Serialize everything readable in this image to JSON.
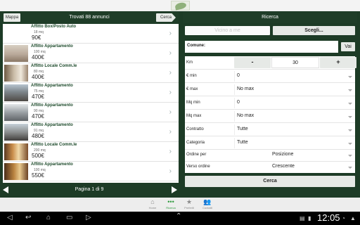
{
  "left_header": {
    "map_button": "Mappa",
    "title": "Trovati 88 annunci",
    "search_button": "Cerca"
  },
  "listings": [
    {
      "title": "Affitto Box/Posto Auto",
      "area": "18",
      "unit": "mq",
      "price": "90€",
      "photo": "blank"
    },
    {
      "title": "Affitto Appartamento",
      "area": "100",
      "unit": "mq",
      "price": "400€",
      "photo": "interior"
    },
    {
      "title": "Affitto Locale Comm.le",
      "area": "80",
      "unit": "mq",
      "price": "400€",
      "photo": "shop"
    },
    {
      "title": "Affitto Appartamento",
      "area": "75",
      "unit": "mq",
      "price": "470€",
      "photo": "building"
    },
    {
      "title": "Affitto Appartamento",
      "area": "90",
      "unit": "mq",
      "price": "470€",
      "photo": "facade"
    },
    {
      "title": "Affitto Appartamento",
      "area": "91",
      "unit": "mq",
      "price": "480€",
      "photo": "building"
    },
    {
      "title": "Affitto Locale Comm.le",
      "area": "200",
      "unit": "mq",
      "price": "500€",
      "photo": "showroom"
    },
    {
      "title": "Affitto Appartamento",
      "area": "100",
      "unit": "mq",
      "price": "550€",
      "photo": "showroom"
    }
  ],
  "pager": {
    "label": "Pagina 1 di 9"
  },
  "right_header": {
    "title": "Ricerca"
  },
  "near_me": {
    "label": "Vicino a me"
  },
  "choose": {
    "label": "Scegli..."
  },
  "comune": {
    "label": "Comune:",
    "value": "",
    "go_button": "Vai"
  },
  "km": {
    "label": "Km",
    "minus": "-",
    "value": "30",
    "plus": "+"
  },
  "fields": [
    {
      "label": "€ min",
      "value": "0"
    },
    {
      "label": "€ max",
      "value": "No max"
    },
    {
      "label": "Mq min",
      "value": "0"
    },
    {
      "label": "Mq max",
      "value": "No max"
    },
    {
      "label": "Contratto",
      "value": "Tutte"
    },
    {
      "label": "Categoria",
      "value": "Tutte"
    }
  ],
  "sort": [
    {
      "label": "Ordine per",
      "value": "Posizione"
    },
    {
      "label": "Verso ordine",
      "value": "Crescente"
    }
  ],
  "search_button": {
    "label": "Cerca"
  },
  "tabs": [
    {
      "label": "Home",
      "icon": "house-icon"
    },
    {
      "label": "Ricerca",
      "icon": "dots-icon",
      "active": true
    },
    {
      "label": "Preferiti",
      "icon": "star-icon"
    },
    {
      "label": "Contatti",
      "icon": "people-icon"
    }
  ],
  "status": {
    "time": "12:05"
  },
  "colors": {
    "brand_green": "#1d3b26",
    "accent_green": "#2e9b3e"
  }
}
